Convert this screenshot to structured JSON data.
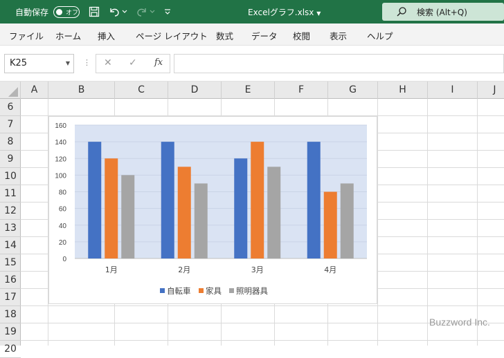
{
  "titlebar": {
    "autosave_label": "自動保存",
    "autosave_state": "オフ",
    "filename": "Excelグラフ.xlsx",
    "search_placeholder": "検索 (Alt+Q)"
  },
  "menu": [
    "ファイル",
    "ホーム",
    "挿入",
    "ページ レイアウト",
    "数式",
    "データ",
    "校閲",
    "表示",
    "ヘルプ"
  ],
  "formula_bar": {
    "name_box": "K25",
    "fx_label": "fx",
    "formula": ""
  },
  "columns": [
    "A",
    "B",
    "C",
    "D",
    "E",
    "F",
    "G",
    "H",
    "I",
    "J"
  ],
  "rows": [
    "6",
    "7",
    "8",
    "9",
    "10",
    "11",
    "12",
    "13",
    "14",
    "15",
    "16",
    "17",
    "18",
    "19",
    "20"
  ],
  "watermark": "Buzzword Inc.",
  "chart_data": {
    "type": "bar",
    "categories": [
      "1月",
      "2月",
      "3月",
      "4月"
    ],
    "series": [
      {
        "name": "自転車",
        "values": [
          140,
          140,
          120,
          140
        ],
        "color": "#4472c4"
      },
      {
        "name": "家具",
        "values": [
          120,
          110,
          140,
          80
        ],
        "color": "#ed7d31"
      },
      {
        "name": "照明器具",
        "values": [
          100,
          90,
          110,
          90
        ],
        "color": "#a5a5a5"
      }
    ],
    "ylim": [
      0,
      160
    ],
    "yticks": [
      0,
      20,
      40,
      60,
      80,
      100,
      120,
      140,
      160
    ],
    "plot_background": "#dae3f3",
    "grid": true,
    "legend": "bottom",
    "title": "",
    "xlabel": "",
    "ylabel": ""
  }
}
